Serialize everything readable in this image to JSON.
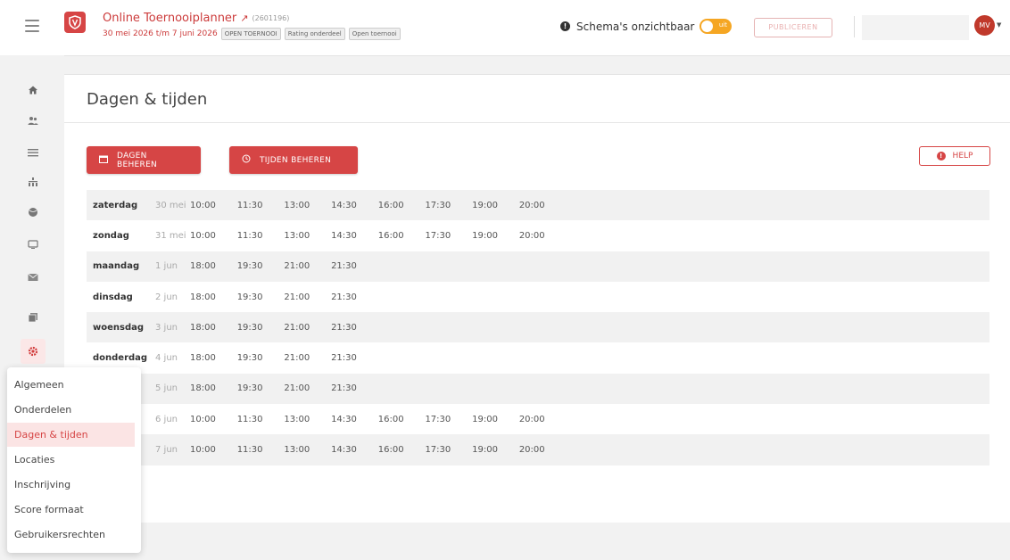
{
  "header": {
    "app_title": "Online Toernooiplanner",
    "tournament_id": "(2601196)",
    "date_range": "30 mei 2026 t/m 7 juni 2026",
    "tags": [
      "OPEN TOERNOOI",
      "Rating onderdeel",
      "Open toernooi"
    ],
    "schema_label": "Schema's onzichtbaar",
    "toggle_label": "uit",
    "publish_label": "PUBLICEREN",
    "avatar_initials": "MV"
  },
  "sidebar": {
    "icons": [
      "home-icon",
      "users-icon",
      "list-icon",
      "bracket-icon",
      "ball-icon",
      "screen-icon",
      "mail-icon",
      "documents-icon",
      "settings-icon"
    ]
  },
  "page": {
    "title": "Dagen & tijden",
    "btn_days": "DAGEN BEHEREN",
    "btn_times": "TIJDEN BEHEREN",
    "btn_help": "HELP"
  },
  "schedule": [
    {
      "day": "zaterdag",
      "date": "30 mei",
      "times": [
        "10:00",
        "11:30",
        "13:00",
        "14:30",
        "16:00",
        "17:30",
        "19:00",
        "20:00"
      ]
    },
    {
      "day": "zondag",
      "date": "31 mei",
      "times": [
        "10:00",
        "11:30",
        "13:00",
        "14:30",
        "16:00",
        "17:30",
        "19:00",
        "20:00"
      ]
    },
    {
      "day": "maandag",
      "date": "1 jun",
      "times": [
        "18:00",
        "19:30",
        "21:00",
        "21:30",
        "",
        "",
        "",
        ""
      ]
    },
    {
      "day": "dinsdag",
      "date": "2 jun",
      "times": [
        "18:00",
        "19:30",
        "21:00",
        "21:30",
        "",
        "",
        "",
        ""
      ]
    },
    {
      "day": "woensdag",
      "date": "3 jun",
      "times": [
        "18:00",
        "19:30",
        "21:00",
        "21:30",
        "",
        "",
        "",
        ""
      ]
    },
    {
      "day": "donderdag",
      "date": "4 jun",
      "times": [
        "18:00",
        "19:30",
        "21:00",
        "21:30",
        "",
        "",
        "",
        ""
      ]
    },
    {
      "day": "",
      "date": "5 jun",
      "times": [
        "18:00",
        "19:30",
        "21:00",
        "21:30",
        "",
        "",
        "",
        ""
      ]
    },
    {
      "day": "",
      "date": "6 jun",
      "times": [
        "10:00",
        "11:30",
        "13:00",
        "14:30",
        "16:00",
        "17:30",
        "19:00",
        "20:00"
      ]
    },
    {
      "day": "",
      "date": "7 jun",
      "times": [
        "10:00",
        "11:30",
        "13:00",
        "14:30",
        "16:00",
        "17:30",
        "19:00",
        "20:00"
      ]
    }
  ],
  "menu": {
    "items": [
      "Algemeen",
      "Onderdelen",
      "Dagen & tijden",
      "Locaties",
      "Inschrijving",
      "Score formaat",
      "Gebruikersrechten"
    ],
    "active_index": 2
  },
  "colors": {
    "brand_red": "#d64545",
    "accent_orange": "#f5a623"
  }
}
